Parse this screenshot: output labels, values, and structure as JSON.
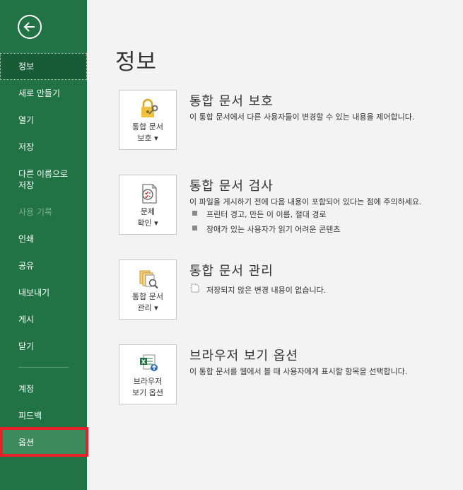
{
  "nav": {
    "back_icon": "back-arrow-icon",
    "items": [
      {
        "label": "정보",
        "state": "active"
      },
      {
        "label": "새로 만들기"
      },
      {
        "label": "열기"
      },
      {
        "label": "저장"
      },
      {
        "label": "다른 이름으로 저장"
      },
      {
        "label": "사용 기록",
        "state": "disabled"
      },
      {
        "label": "인쇄"
      },
      {
        "label": "공유"
      },
      {
        "label": "내보내기"
      },
      {
        "label": "게시"
      },
      {
        "label": "닫기"
      },
      {
        "label": "계정"
      },
      {
        "label": "피드백"
      },
      {
        "label": "옵션",
        "state": "highlighted"
      }
    ]
  },
  "page": {
    "title": "정보"
  },
  "sections": [
    {
      "card_line1": "통합 문서",
      "card_line2": "보호 ▾",
      "icon": "lock-key-icon",
      "title": "통합 문서 보호",
      "description": "이 통합 문서에서 다른 사용자들이 변경할 수 있는 내용을 제어합니다."
    },
    {
      "card_line1": "문제",
      "card_line2": "확인 ▾",
      "icon": "checklist-icon",
      "title": "통합 문서 검사",
      "description": "이 파일을 게시하기 전에 다음 내용이 포함되어 있다는 점에 주의하세요.",
      "bullets": [
        "프린터 경고, 만든 이 이름, 절대 경로",
        "장애가 있는 사용자가 읽기 어려운 콘텐츠"
      ]
    },
    {
      "card_line1": "통합 문서",
      "card_line2": "관리 ▾",
      "icon": "manage-workbook-icon",
      "title": "통합 문서 관리",
      "description": "저장되지 않은 변경 내용이 없습니다."
    },
    {
      "card_line1": "브라우저",
      "card_line2": "보기 옵션",
      "icon": "browser-view-icon",
      "title": "브라우저 보기 옵션",
      "description": "이 통합 문서를 웹에서 볼 때 사용자에게 표시할 항목을 선택합니다."
    }
  ],
  "colors": {
    "sidebar": "#217346",
    "active": "#185c37",
    "highlight": "#e8202a"
  }
}
